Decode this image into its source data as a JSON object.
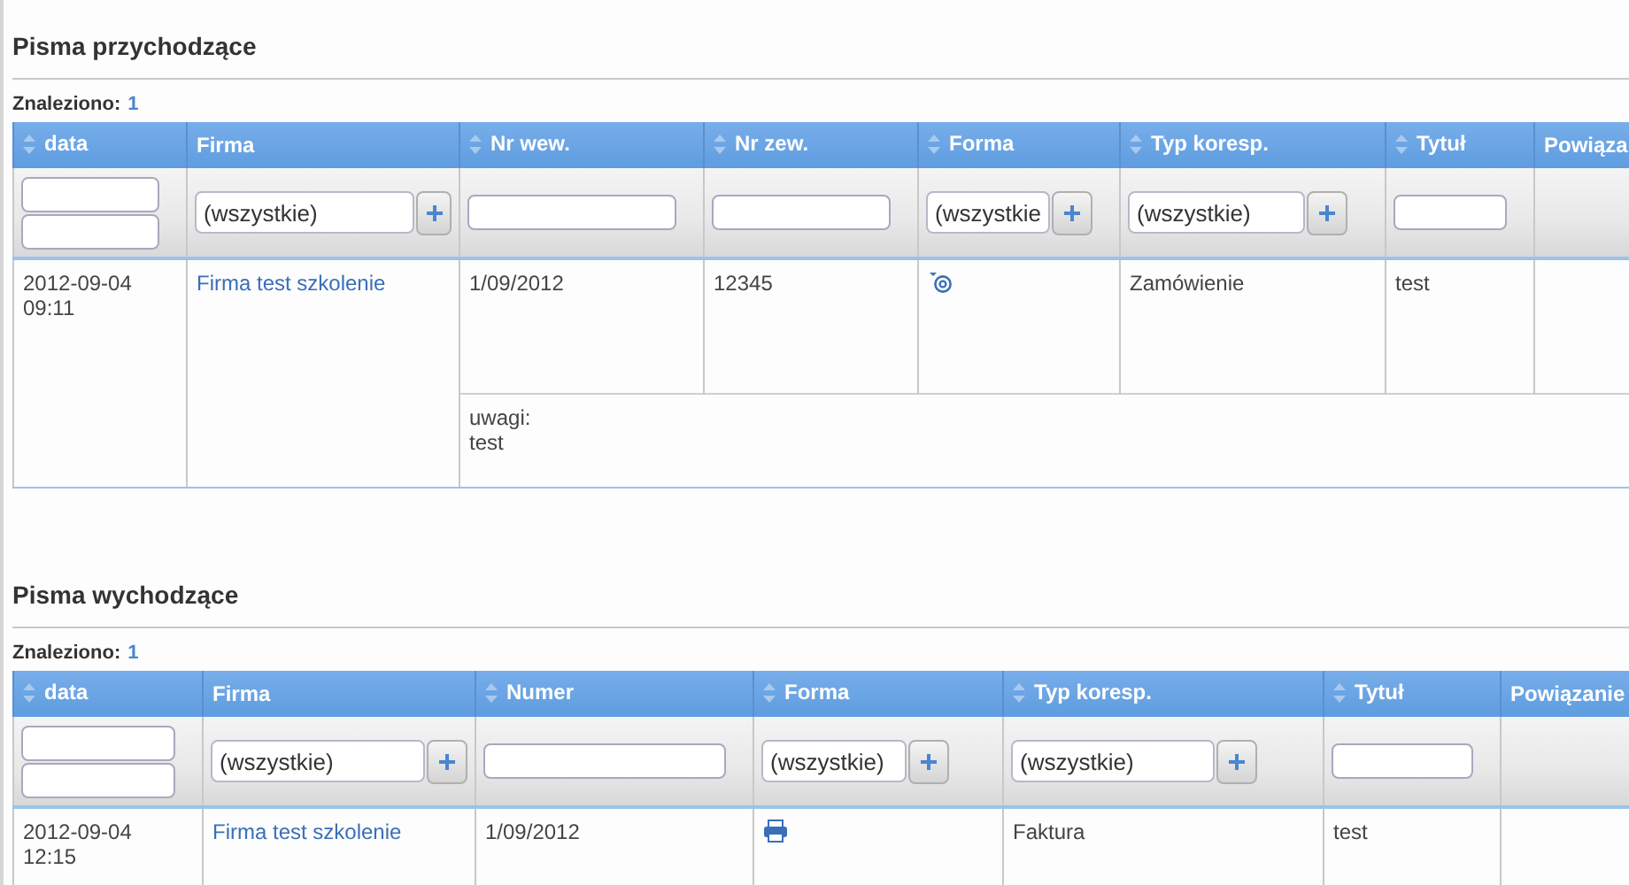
{
  "sections": [
    {
      "title": "Pisma przychodzące",
      "found_label": "Znaleziono:",
      "found_count": "1",
      "table": {
        "columns": [
          {
            "label": "data",
            "sortable": true,
            "filter": {
              "kind": "date-range"
            }
          },
          {
            "label": "Firma",
            "sortable": false,
            "filter": {
              "kind": "select",
              "value": "(wszystkie)"
            }
          },
          {
            "label": "Nr wew.",
            "sortable": true,
            "filter": {
              "kind": "text"
            }
          },
          {
            "label": "Nr zew.",
            "sortable": true,
            "filter": {
              "kind": "text"
            }
          },
          {
            "label": "Forma",
            "sortable": true,
            "filter": {
              "kind": "select",
              "value": "(wszystkie"
            }
          },
          {
            "label": "Typ koresp.",
            "sortable": true,
            "filter": {
              "kind": "select",
              "value": "(wszystkie)"
            }
          },
          {
            "label": "Tytuł",
            "sortable": true,
            "filter": {
              "kind": "text"
            }
          },
          {
            "label": "Powiąza",
            "sortable": false
          }
        ],
        "rows": [
          {
            "cells": [
              {
                "kind": "datetime",
                "date": "2012-09-04",
                "time": "09:11"
              },
              {
                "kind": "link",
                "text": "Firma test szkolenie"
              },
              {
                "kind": "text",
                "text": "1/09/2012"
              },
              {
                "kind": "text",
                "text": "12345"
              },
              {
                "kind": "email"
              },
              {
                "kind": "text",
                "text": "Zamówienie"
              },
              {
                "kind": "text",
                "text": "test"
              }
            ],
            "remark": {
              "label": "uwagi:",
              "text": "test"
            }
          }
        ]
      }
    },
    {
      "title": "Pisma wychodzące",
      "found_label": "Znaleziono:",
      "found_count": "1",
      "table": {
        "columns": [
          {
            "label": "data",
            "sortable": true,
            "filter": {
              "kind": "date-range"
            }
          },
          {
            "label": "Firma",
            "sortable": false,
            "filter": {
              "kind": "select",
              "value": "(wszystkie)"
            }
          },
          {
            "label": "Numer",
            "sortable": true,
            "filter": {
              "kind": "text"
            }
          },
          {
            "label": "Forma",
            "sortable": true,
            "filter": {
              "kind": "select",
              "value": "(wszystkie)"
            }
          },
          {
            "label": "Typ koresp.",
            "sortable": true,
            "filter": {
              "kind": "select",
              "value": "(wszystkie)"
            }
          },
          {
            "label": "Tytuł",
            "sortable": true,
            "filter": {
              "kind": "text"
            }
          },
          {
            "label": "Powiązanie",
            "sortable": false
          }
        ],
        "rows": [
          {
            "cells": [
              {
                "kind": "datetime",
                "date": "2012-09-04",
                "time": "12:15"
              },
              {
                "kind": "link",
                "text": "Firma test szkolenie"
              },
              {
                "kind": "text",
                "text": "1/09/2012"
              },
              {
                "kind": "print"
              },
              {
                "kind": "text",
                "text": "Faktura"
              },
              {
                "kind": "text",
                "text": "test"
              }
            ]
          }
        ]
      }
    }
  ]
}
